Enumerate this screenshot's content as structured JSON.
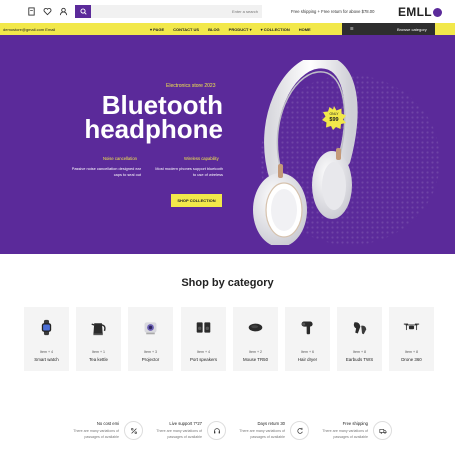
{
  "topbar": {
    "search_placeholder": "Enter a search",
    "shipping_note": "Free shipping + Free return for above $78.00",
    "logo": "EMLL"
  },
  "navbar": {
    "email": "demostore@gmail.com  Email",
    "links": [
      "PAGE",
      "CONTACT US",
      "BLOG",
      "PRODUCT",
      "COLLECTION",
      "HOME"
    ],
    "browse": "Browse category"
  },
  "hero": {
    "store_tag": "Electronics store 2023",
    "title_line1": "Bluetooth",
    "title_line2": "headphone",
    "feature_left_title": "Noise cancellation",
    "feature_left_desc1": "Passive noise cancellation designed ear",
    "feature_left_desc2": "caps to seal out",
    "feature_right_title": "Wireless capability",
    "feature_right_desc1": "Most modern phones support bluetooth",
    "feature_right_desc2": "to use of wireless",
    "cta": "SHOP COLLECTION",
    "badge_only": "ONLY",
    "badge_price": "$99"
  },
  "categories": {
    "title": "Shop by category",
    "items": [
      {
        "count": "Item + 4",
        "name": "Smart watch",
        "icon": "smartwatch-icon"
      },
      {
        "count": "Item + 1",
        "name": "Tea kettle",
        "icon": "kettle-icon"
      },
      {
        "count": "Item + 3",
        "name": "Projector",
        "icon": "projector-icon"
      },
      {
        "count": "Item + 4",
        "name": "Port speakers",
        "icon": "speaker-icon"
      },
      {
        "count": "Item + 2",
        "name": "Mouse TR50",
        "icon": "mouse-icon"
      },
      {
        "count": "Item + 6",
        "name": "Hair dryer",
        "icon": "hairdryer-icon"
      },
      {
        "count": "Item + 8",
        "name": "Earbuds TWS",
        "icon": "earbuds-icon"
      },
      {
        "count": "Item + 8",
        "name": "Drone 360",
        "icon": "drone-icon"
      }
    ]
  },
  "services": [
    {
      "title": "No cost emi",
      "desc1": "There are many variations of",
      "desc2": "passages of available",
      "icon": "percent-icon"
    },
    {
      "title": "Live support 7*27",
      "desc1": "There are many variations of",
      "desc2": "passages of available",
      "icon": "headset-icon"
    },
    {
      "title": "Days return 30",
      "desc1": "There are many variations of",
      "desc2": "passages of available",
      "icon": "return-icon"
    },
    {
      "title": "Free shipping",
      "desc1": "There are many variations of",
      "desc2": "passages of available",
      "icon": "truck-icon"
    }
  ],
  "colors": {
    "primary": "#5b2a9a",
    "accent": "#f2e84a",
    "dark": "#2e2e2e"
  }
}
